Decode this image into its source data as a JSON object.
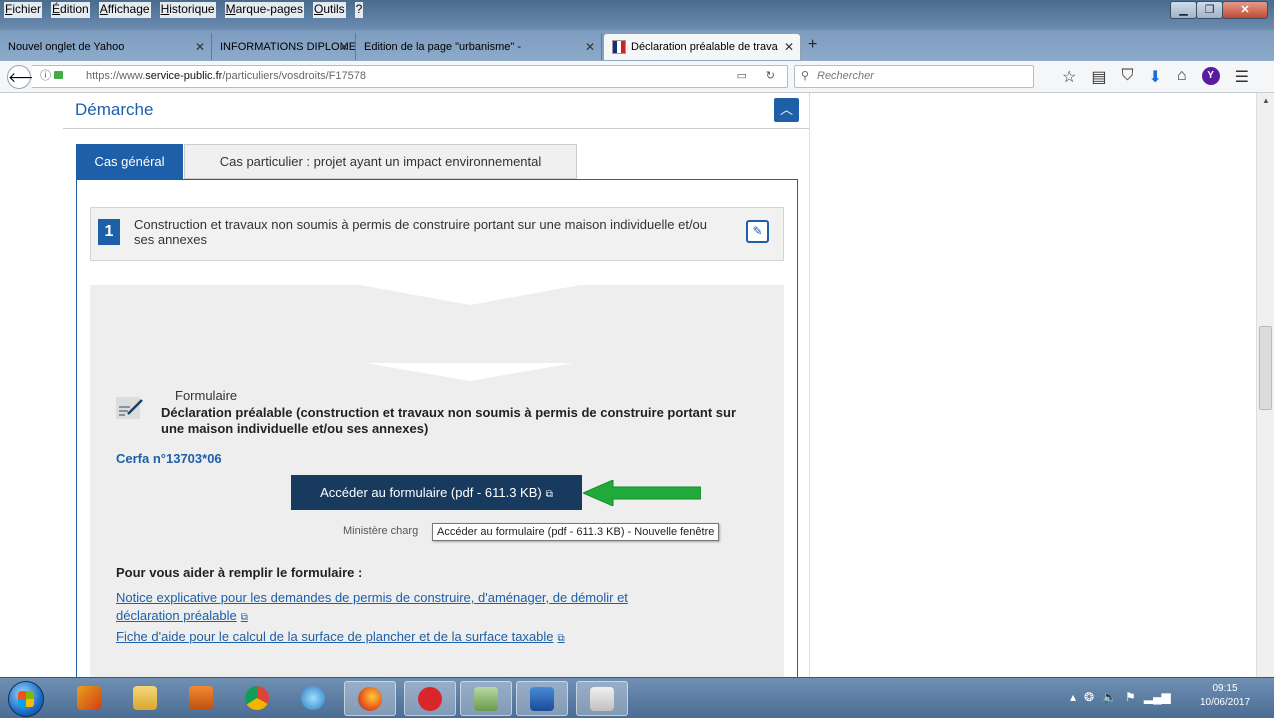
{
  "menubar": [
    "Fichier",
    "Édition",
    "Affichage",
    "Historique",
    "Marque-pages",
    "Outils",
    "?"
  ],
  "tabs": [
    {
      "label": "Nouvel onglet de Yahoo"
    },
    {
      "label": "INFORMATIONS DIPLOME NATIO"
    },
    {
      "label": "Edition de la page \"urbanisme\" -"
    },
    {
      "label": "Déclaration préalable de trava"
    }
  ],
  "nav": {
    "url_prefix": "https://www.",
    "url_host": "service-public.fr",
    "url_path": "/particuliers/vosdroits/F17578",
    "search_placeholder": "Rechercher"
  },
  "page": {
    "section_title": "Démarche",
    "tab_general": "Cas général",
    "tab_particular": "Cas particulier : projet ayant un impact environnemental",
    "step_number": "1",
    "step_text": "Construction et travaux non soumis à permis de construire portant sur une maison individuelle et/ou ses annexes",
    "form_label": "Formulaire",
    "form_title": "Déclaration préalable (construction et travaux non soumis à permis de construire portant sur une maison individuelle et/ou ses annexes)",
    "cerfa": "Cerfa n°13703*06",
    "access_button": "Accéder au formulaire (pdf - 611.3 KB)",
    "ministere": "Ministère charg",
    "tooltip": "Accéder au formulaire (pdf - 611.3 KB) - Nouvelle fenêtre",
    "help_title": "Pour vous aider à remplir le formulaire :",
    "help_link_1a": "Notice explicative pour les demandes de permis de construire, d'aménager, de démolir et",
    "help_link_1b": "déclaration préalable",
    "help_link_2": "Fiche d'aide pour le calcul de la surface de plancher et de la surface taxable"
  },
  "taskbar": {
    "time": "09:15",
    "date": "10/06/2017"
  },
  "colors": {
    "accent": "#1d5fa8",
    "button_dark": "#173a5e",
    "arrow": "#1faa3a"
  }
}
